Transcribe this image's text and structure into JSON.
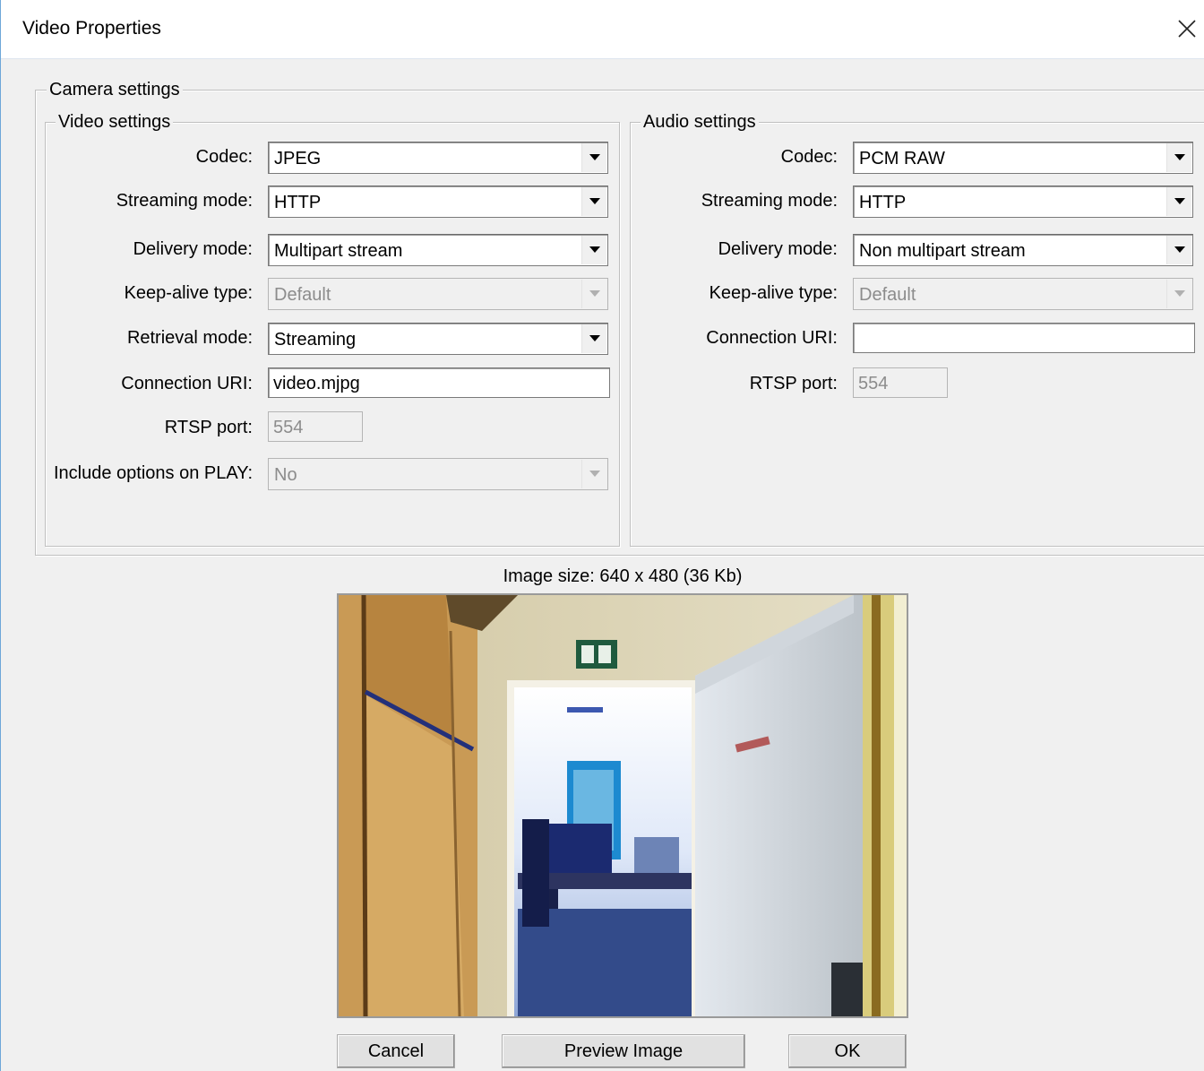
{
  "window": {
    "title": "Video Properties"
  },
  "camera_settings": {
    "legend": "Camera settings",
    "video": {
      "legend": "Video settings",
      "codec": {
        "label": "Codec:",
        "value": "JPEG"
      },
      "streaming_mode": {
        "label": "Streaming mode:",
        "value": "HTTP"
      },
      "delivery_mode": {
        "label": "Delivery mode:",
        "value": "Multipart stream"
      },
      "keep_alive": {
        "label": "Keep-alive type:",
        "value": "Default"
      },
      "retrieval_mode": {
        "label": "Retrieval mode:",
        "value": "Streaming"
      },
      "connection_uri": {
        "label": "Connection URI:",
        "value": "video.mjpg"
      },
      "rtsp_port": {
        "label": "RTSP port:",
        "value": "554"
      },
      "include_options": {
        "label": "Include options on PLAY:",
        "value": "No"
      }
    },
    "audio": {
      "legend": "Audio settings",
      "codec": {
        "label": "Codec:",
        "value": "PCM RAW"
      },
      "streaming_mode": {
        "label": "Streaming mode:",
        "value": "HTTP"
      },
      "delivery_mode": {
        "label": "Delivery mode:",
        "value": "Non multipart stream"
      },
      "keep_alive": {
        "label": "Keep-alive type:",
        "value": "Default"
      },
      "connection_uri": {
        "label": "Connection URI:",
        "value": ""
      },
      "rtsp_port": {
        "label": "RTSP port:",
        "value": "554"
      }
    }
  },
  "preview": {
    "image_size": "Image size: 640 x 480 (36 Kb)"
  },
  "buttons": {
    "cancel": "Cancel",
    "preview_image": "Preview Image",
    "ok": "OK"
  },
  "icons": {
    "close": "close-icon",
    "dropdown": "chevron-down-icon"
  }
}
